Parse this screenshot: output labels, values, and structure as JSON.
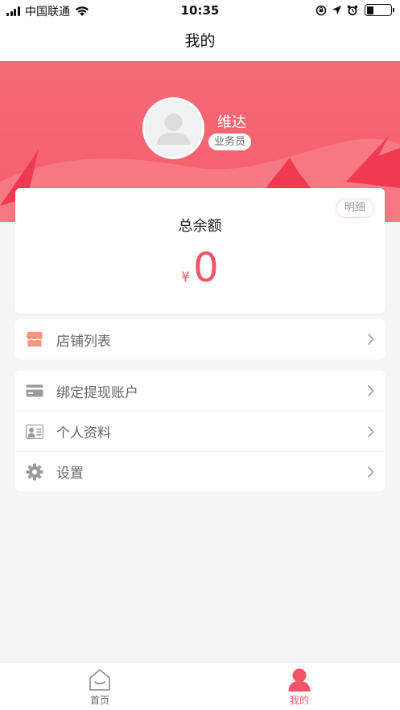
{
  "status_bar": {
    "carrier": "中国联通",
    "time": "10:35",
    "battery_level": 0.3
  },
  "header": {
    "title": "我的"
  },
  "profile": {
    "name": "维达",
    "role": "业务员"
  },
  "balance": {
    "detail_label": "明细",
    "title": "总余额",
    "currency": "¥",
    "amount": "0"
  },
  "menu_store": {
    "items": [
      {
        "label": "店铺列表",
        "icon": "store-icon"
      }
    ]
  },
  "menu_account": {
    "items": [
      {
        "label": "绑定提现账户",
        "icon": "card-icon"
      },
      {
        "label": "个人资料",
        "icon": "id-card-icon"
      },
      {
        "label": "设置",
        "icon": "gear-icon"
      }
    ]
  },
  "tab_bar": {
    "tabs": [
      {
        "label": "首页",
        "icon": "home-icon",
        "active": false
      },
      {
        "label": "我的",
        "icon": "person-icon",
        "active": true
      }
    ]
  },
  "colors": {
    "accent": "#f2546a",
    "hero": "#f66a77",
    "store_icon": "#f6957e",
    "icon_gray": "#9b9b9b"
  }
}
